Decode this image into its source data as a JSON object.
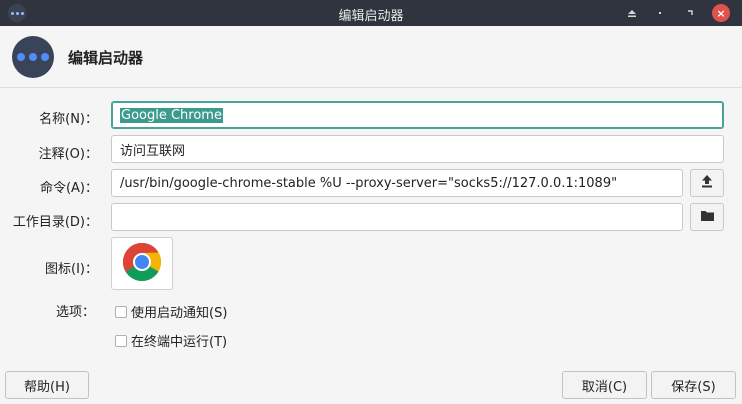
{
  "window": {
    "title": "编辑启动器",
    "controls": [
      "shade-icon",
      "minimize-icon",
      "maximize-icon",
      "close-icon"
    ]
  },
  "header": {
    "title": "编辑启动器",
    "icon": "launcher-dots-icon"
  },
  "form": {
    "name_label": "名称(N)：",
    "name_value": "Google Chrome",
    "comment_label": "注释(O)：",
    "comment_value": "访问互联网",
    "command_label": "命令(A)：",
    "command_value": "/usr/bin/google-chrome-stable %U --proxy-server=\"socks5://127.0.0.1:1089\"",
    "workdir_label": "工作目录(D)：",
    "workdir_value": "",
    "icon_label": "图标(I)：",
    "icon_name": "chrome-icon",
    "options_label": "选项：",
    "options": [
      {
        "label": "使用启动通知(S)",
        "checked": false
      },
      {
        "label": "在终端中运行(T)",
        "checked": false
      }
    ]
  },
  "buttons": {
    "help": "帮助(H)",
    "cancel": "取消(C)",
    "save": "保存(S)"
  },
  "colors": {
    "titlebar": "#2f343f",
    "selection": "#3d9b8e",
    "close": "#e0534d"
  }
}
